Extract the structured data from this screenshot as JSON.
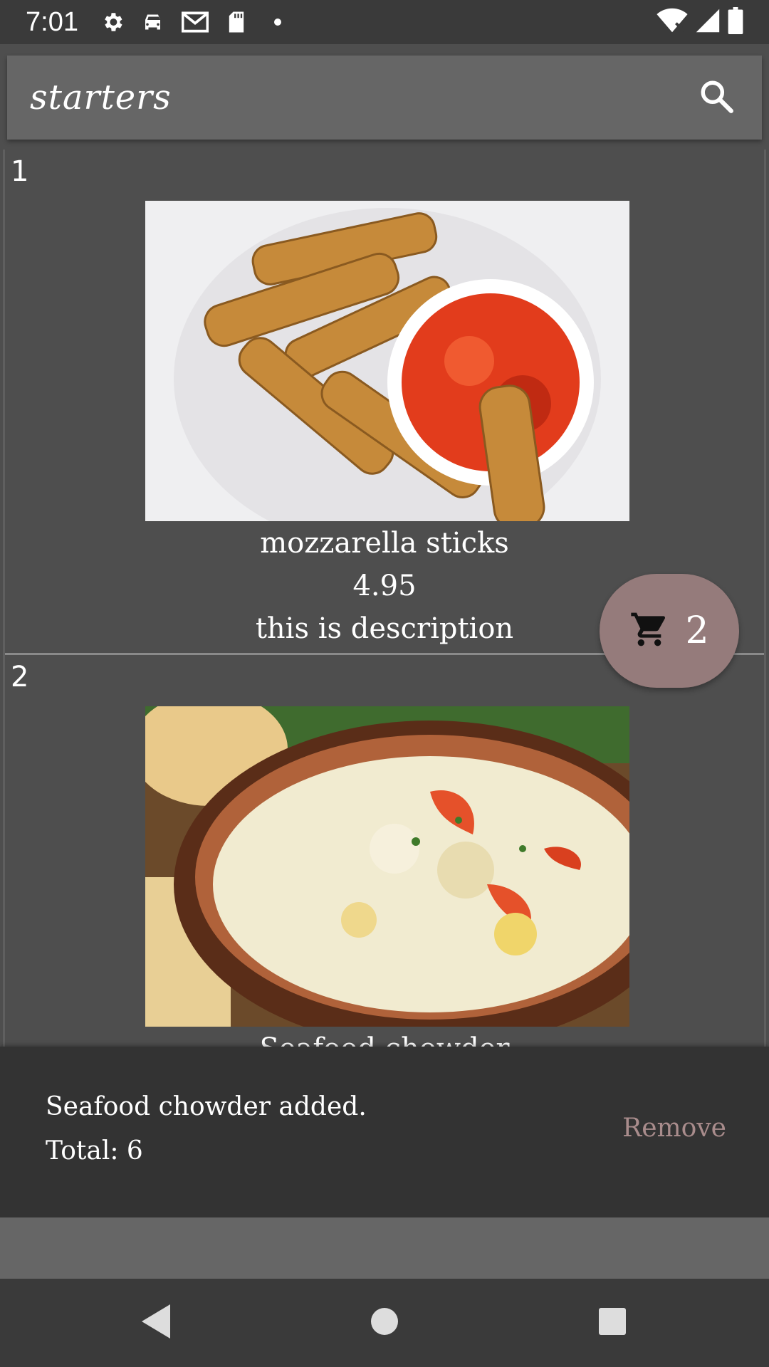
{
  "status_bar": {
    "time": "7:01",
    "left_icons": [
      "gear-icon",
      "car-icon",
      "mail-icon",
      "sdcard-icon",
      "dot-icon"
    ],
    "right_icons": [
      "wifi-icon",
      "signal-icon",
      "battery-icon"
    ]
  },
  "app_bar": {
    "title": "starters",
    "search_icon": "search-icon"
  },
  "items": [
    {
      "index": "1",
      "name": "mozzarella sticks",
      "price": "4.95",
      "description": "this is description"
    },
    {
      "index": "2",
      "name": "Seafood chowder",
      "price": "",
      "description": ""
    }
  ],
  "cart": {
    "icon": "cart-icon",
    "count": "2"
  },
  "snackbar": {
    "message": "Seafood chowder added.",
    "total": "Total: 6",
    "action": "Remove"
  },
  "nav": {
    "back_icon": "back-icon",
    "home_icon": "home-icon",
    "recents_icon": "recents-icon"
  },
  "colors": {
    "status_bar": "#3a3a3a",
    "app_bar": "#666666",
    "background": "#4e4e4e",
    "fab": "#957b7b",
    "snackbar": "#333333",
    "snackbar_action": "#a98c8c"
  }
}
